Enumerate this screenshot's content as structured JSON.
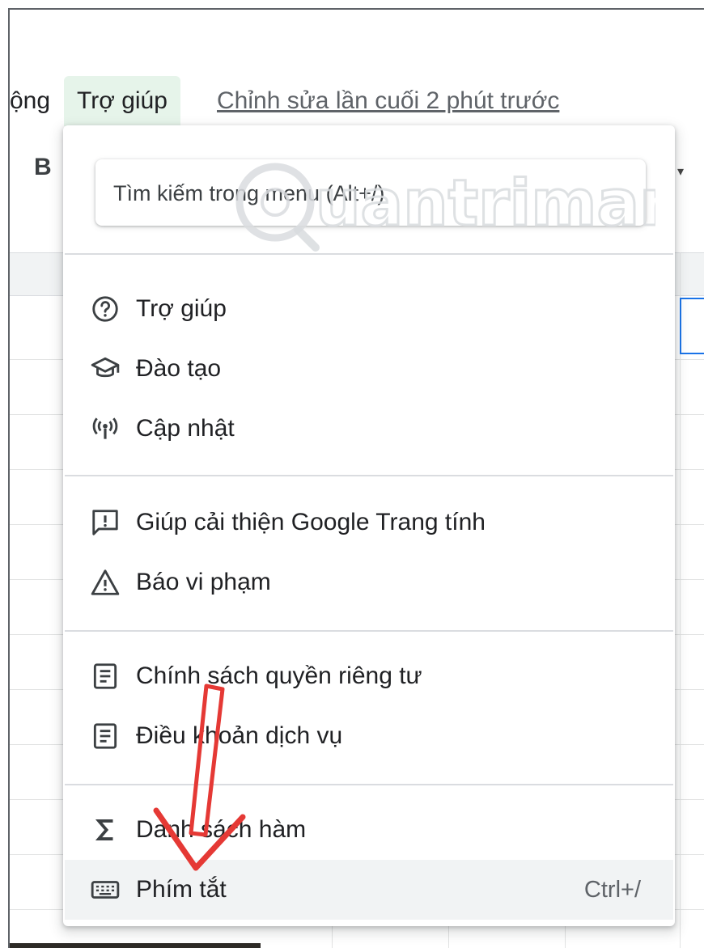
{
  "menubar": {
    "partial_item": "ộng",
    "active_item": "Trợ giúp",
    "last_edit": "Chỉnh sửa lần cuối 2 phút trước"
  },
  "toolbar": {
    "bold_label": "B"
  },
  "watermark": {
    "text": "uantrimang"
  },
  "help_menu": {
    "search_placeholder": "Tìm kiếm trong menu (Alt+/)",
    "groups": [
      [
        {
          "label": "Trợ giúp",
          "icon": "help-circle-icon"
        },
        {
          "label": "Đào tạo",
          "icon": "graduation-cap-icon"
        },
        {
          "label": "Cập nhật",
          "icon": "broadcast-icon"
        }
      ],
      [
        {
          "label": "Giúp cải thiện Google Trang tính",
          "icon": "feedback-icon"
        },
        {
          "label": "Báo vi phạm",
          "icon": "warning-icon"
        }
      ],
      [
        {
          "label": "Chính sách quyền riêng tư",
          "icon": "document-icon"
        },
        {
          "label": "Điều khoản dịch vụ",
          "icon": "document-icon"
        }
      ],
      [
        {
          "label": "Danh sách hàm",
          "icon": "sigma-icon"
        },
        {
          "label": "Phím tắt",
          "icon": "keyboard-icon",
          "shortcut": "Ctrl+/",
          "highlighted": true
        }
      ]
    ]
  },
  "colors": {
    "active_menu_bg": "#e6f4ea",
    "highlight_bg": "#f1f3f4",
    "selection_border": "#1a73e8",
    "annotation_arrow": "#e53935"
  }
}
